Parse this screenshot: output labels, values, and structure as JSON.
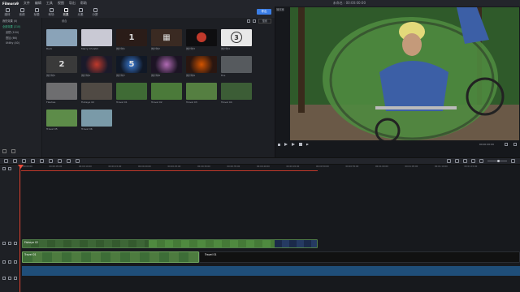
{
  "menubar": {
    "app_name": "Filmora9",
    "items": [
      "文件",
      "编辑",
      "工具",
      "视图",
      "导出",
      "帮助"
    ],
    "project_title": "未命名 : 00:00:00:00"
  },
  "modtabs": [
    {
      "label": "媒体",
      "active": false
    },
    {
      "label": "音频",
      "active": false
    },
    {
      "label": "标题",
      "active": false
    },
    {
      "label": "转场",
      "active": false
    },
    {
      "label": "效果",
      "active": true
    },
    {
      "label": "元素",
      "active": false
    },
    {
      "label": "分屏",
      "active": false
    }
  ],
  "export_label": "导出",
  "sidebar": {
    "items": [
      {
        "label": "我的效果 (0)",
        "selected": false
      },
      {
        "label": "全部效果 (210)",
        "selected": true
      },
      {
        "label": "滤镜 (104)",
        "selected": false
      },
      {
        "label": "叠加 (66)",
        "selected": false
      },
      {
        "label": "Utility (40)",
        "selected": false
      }
    ]
  },
  "media_bar": {
    "sort_label": "搜索",
    "dropdown_label": "综合"
  },
  "thumbnails": [
    {
      "label": "Back",
      "color": "#8aa3b8",
      "kind": "photo"
    },
    {
      "label": "Merry Christm",
      "color": "#c9c9d4",
      "kind": "photo"
    },
    {
      "label": "倒计时1",
      "color": "#2a1c18",
      "kind": "count",
      "mark": "1"
    },
    {
      "label": "倒计时2",
      "color": "#3a2a22",
      "kind": "count",
      "mark": "▦"
    },
    {
      "label": "倒计时3",
      "color": "#0e0e10",
      "kind": "circle-red",
      "mark": ""
    },
    {
      "label": "倒计时4",
      "color": "#e8e8e8",
      "kind": "circle-white",
      "mark": "3"
    },
    {
      "label": "倒计时5",
      "color": "#3a3a3a",
      "kind": "count",
      "mark": "2"
    },
    {
      "label": "倒计时6",
      "color": "#1a1a2a",
      "kind": "glow-red",
      "mark": ""
    },
    {
      "label": "倒计时7",
      "color": "#101826",
      "kind": "glow-blue",
      "mark": "5"
    },
    {
      "label": "倒计时8",
      "color": "#1c1424",
      "kind": "glow-purple",
      "mark": ""
    },
    {
      "label": "倒计时9",
      "color": "#2a1610",
      "kind": "fire",
      "mark": ""
    },
    {
      "label": "Fire",
      "color": "#565a5e",
      "kind": "photo"
    },
    {
      "label": "Flashes",
      "color": "#6e6e70",
      "kind": "photo"
    },
    {
      "label": "Fisheye 02",
      "color": "#504a44",
      "kind": "photo"
    },
    {
      "label": "Travel 01",
      "color": "#3f6b35",
      "kind": "photo"
    },
    {
      "label": "Travel 02",
      "color": "#4b7a3a",
      "kind": "photo"
    },
    {
      "label": "Travel 03",
      "color": "#557f41",
      "kind": "photo"
    },
    {
      "label": "Travel 04",
      "color": "#3c5d36",
      "kind": "photo"
    },
    {
      "label": "Travel 05",
      "color": "#5d8c49",
      "kind": "photo"
    },
    {
      "label": "Travel 06",
      "color": "#7a9aa8",
      "kind": "photo"
    }
  ],
  "preview": {
    "timecode_label": "播放器",
    "time": "00:00:00:00"
  },
  "timeline": {
    "ruler_ticks": [
      "00:00:00:00",
      "00:00:05:00",
      "00:00:10:00",
      "00:00:15:00",
      "00:00:20:00",
      "00:00:25:00",
      "00:00:30:00",
      "00:00:35:00",
      "00:00:40:00",
      "00:00:45:00",
      "00:00:50:00",
      "00:00:55:00",
      "00:01:00:00",
      "00:01:05:00",
      "00:01:10:00",
      "00:01:15:00"
    ],
    "clip_video_label": "Travel 01",
    "clip_effect_label": "Fisheye 02"
  },
  "colors": {
    "accent": "#3b7ee6",
    "select_green": "#3fbf8f",
    "playhead": "#e74c3c",
    "audio": "#1f4e79"
  }
}
